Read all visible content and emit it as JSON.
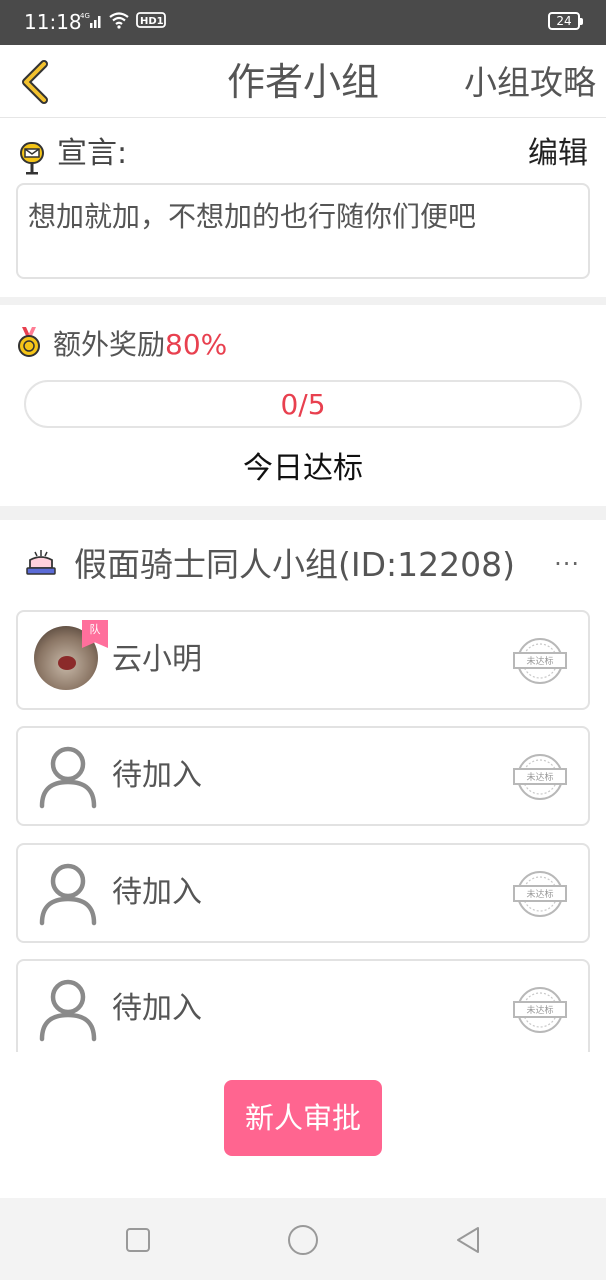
{
  "status_bar": {
    "time": "11:18",
    "network": "4G",
    "hd": "HD1",
    "battery": "24"
  },
  "header": {
    "back_icon": "chevron-left-icon",
    "title": "作者小组",
    "right_label": "小组攻略"
  },
  "declaration": {
    "icon": "mailbox-icon",
    "label": "宣言:",
    "edit_label": "编辑",
    "text": "想加就加，不想加的也行随你们便吧"
  },
  "bonus": {
    "icon": "medal-icon",
    "label": "额外奖励",
    "percent": "80%",
    "progress_text": "0/5",
    "progress_fraction": 0,
    "today_label": "今日达标"
  },
  "group": {
    "icon": "group-sign-icon",
    "name": "假面骑士同人小组(ID:12208)",
    "more_label": "···"
  },
  "members": [
    {
      "name": "云小明",
      "badge": "队",
      "status": "未达标",
      "avatar": "photo"
    },
    {
      "name": "待加入",
      "status": "未达标",
      "avatar": "placeholder-user-icon"
    },
    {
      "name": "待加入",
      "status": "未达标",
      "avatar": "placeholder-user-icon"
    },
    {
      "name": "待加入",
      "status": "未达标",
      "avatar": "placeholder-user-icon"
    }
  ],
  "approve_button": "新人审批",
  "colors": {
    "accent": "#ff6590",
    "highlight_red": "#e8404f",
    "back_arrow": "#f2c12e"
  }
}
